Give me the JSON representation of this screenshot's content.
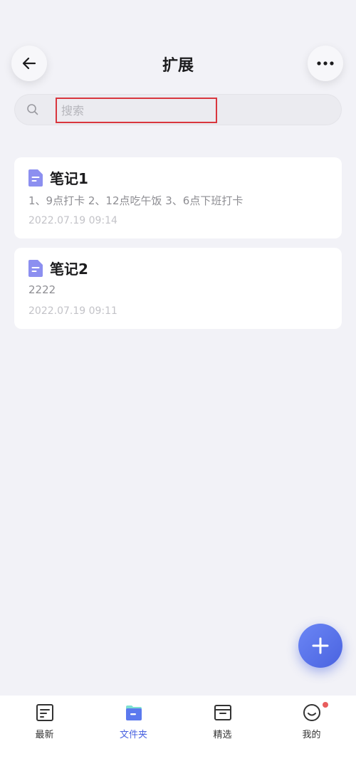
{
  "header": {
    "title": "扩展",
    "back_icon": "arrow-left-icon",
    "more_icon": "more-horizontal-icon"
  },
  "search": {
    "placeholder": "搜索",
    "value": ""
  },
  "notes": [
    {
      "title": "笔记1",
      "preview": "1、9点打卡 2、12点吃午饭 3、6点下班打卡",
      "date": "2022.07.19 09:14"
    },
    {
      "title": "笔记2",
      "preview": "2222",
      "date": "2022.07.19 09:11"
    }
  ],
  "fab": {
    "icon": "plus-icon"
  },
  "tabbar": {
    "items": [
      {
        "label": "最新",
        "icon": "note-list-icon",
        "active": false
      },
      {
        "label": "文件夹",
        "icon": "folder-icon",
        "active": true
      },
      {
        "label": "精选",
        "icon": "archive-box-icon",
        "active": false
      },
      {
        "label": "我的",
        "icon": "smiley-face-icon",
        "active": false,
        "badge": true
      }
    ]
  },
  "colors": {
    "accent": "#4a63e0",
    "background": "#f2f2f7",
    "highlight_border": "#d9363e",
    "doc_icon": "#8c8ff0",
    "badge": "#e85d5d"
  }
}
